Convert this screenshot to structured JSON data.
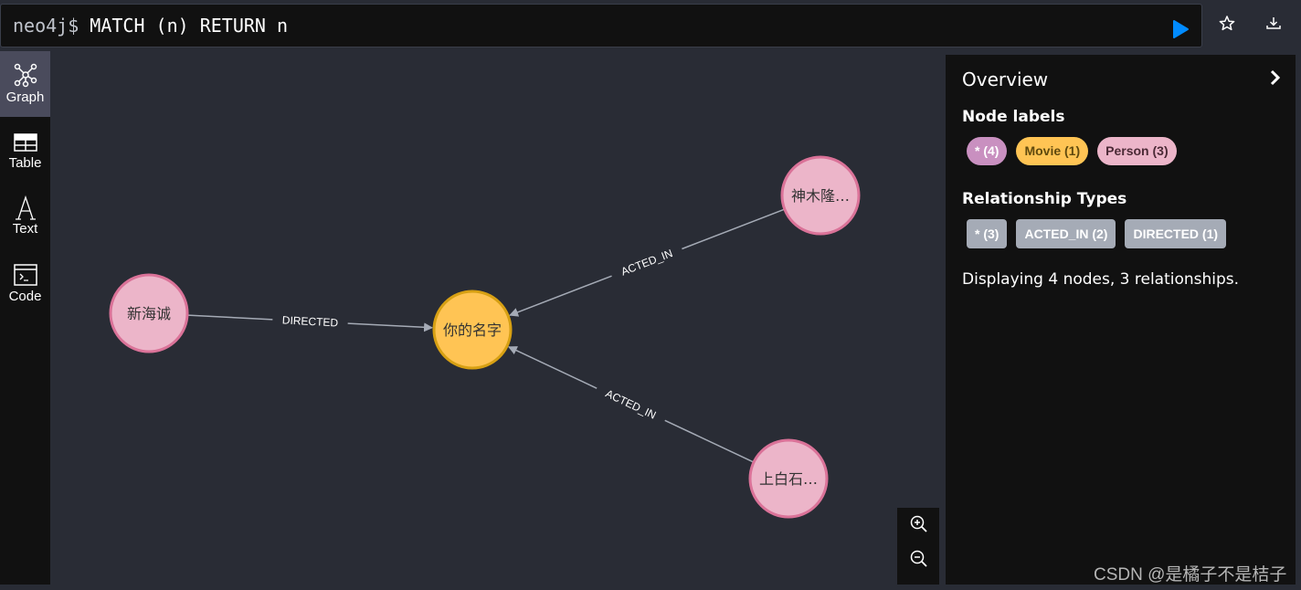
{
  "editor": {
    "prompt": "neo4j$",
    "query": "MATCH (n) RETURN n",
    "run_icon": "play-icon",
    "favorite_icon": "star-icon",
    "download_icon": "download-icon",
    "run_color": "#018bff"
  },
  "sidebar": {
    "items": [
      {
        "label": "Graph",
        "icon": "graph-icon",
        "active": true
      },
      {
        "label": "Table",
        "icon": "table-icon",
        "active": false
      },
      {
        "label": "Text",
        "icon": "text-icon",
        "active": false
      },
      {
        "label": "Code",
        "icon": "code-icon",
        "active": false
      }
    ]
  },
  "graph": {
    "nodes": [
      {
        "id": "n0",
        "label": "新海诚",
        "type": "Person",
        "fill": "#ecb5c9",
        "stroke": "#da7298"
      },
      {
        "id": "n1",
        "label": "你的名字",
        "type": "Movie",
        "fill": "#ffc454",
        "stroke": "#d7a013"
      },
      {
        "id": "n2",
        "label": "神木隆…",
        "type": "Person",
        "fill": "#ecb5c9",
        "stroke": "#da7298"
      },
      {
        "id": "n3",
        "label": "上白石…",
        "type": "Person",
        "fill": "#ecb5c9",
        "stroke": "#da7298"
      }
    ],
    "relationships": [
      {
        "from": "n0",
        "to": "n1",
        "type": "DIRECTED"
      },
      {
        "from": "n2",
        "to": "n1",
        "type": "ACTED_IN"
      },
      {
        "from": "n3",
        "to": "n1",
        "type": "ACTED_IN"
      }
    ],
    "edge_color": "#a5abb6",
    "zoom_in_icon": "zoom-in-icon",
    "zoom_out_icon": "zoom-out-icon"
  },
  "overview": {
    "title": "Overview",
    "collapse_icon": "chevron-right-icon",
    "node_labels_title": "Node labels",
    "node_labels": [
      {
        "text": "* (4)",
        "bg": "#c990c0",
        "color": "#ffffff"
      },
      {
        "text": "Movie (1)",
        "bg": "#ffc454",
        "color": "#604a0e"
      },
      {
        "text": "Person (3)",
        "bg": "#ecb5c9",
        "color": "#4b2a36"
      }
    ],
    "relationship_types_title": "Relationship Types",
    "relationship_types": [
      {
        "text": "* (3)"
      },
      {
        "text": "ACTED_IN (2)"
      },
      {
        "text": "DIRECTED (1)"
      }
    ],
    "summary": "Displaying 4 nodes, 3 relationships."
  },
  "watermark": "CSDN @是橘子不是桔子"
}
